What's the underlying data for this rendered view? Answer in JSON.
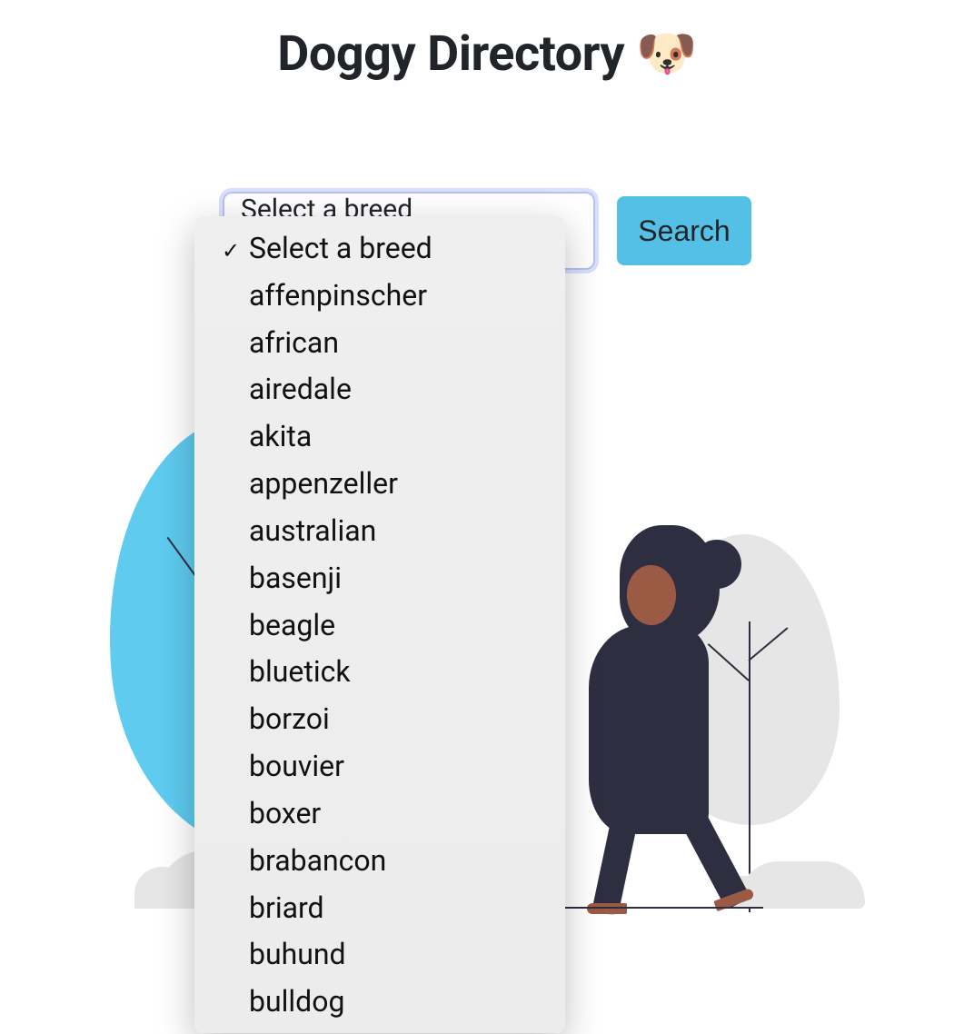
{
  "header": {
    "title": "Doggy Directory 🐶"
  },
  "controls": {
    "select_placeholder": "Select a breed",
    "selected_value": "Select a breed",
    "search_label": "Search"
  },
  "breeds": [
    "Select a breed",
    "affenpinscher",
    "african",
    "airedale",
    "akita",
    "appenzeller",
    "australian",
    "basenji",
    "beagle",
    "bluetick",
    "borzoi",
    "bouvier",
    "boxer",
    "brabancon",
    "briard",
    "buhund",
    "bulldog"
  ],
  "selected_index": 0
}
